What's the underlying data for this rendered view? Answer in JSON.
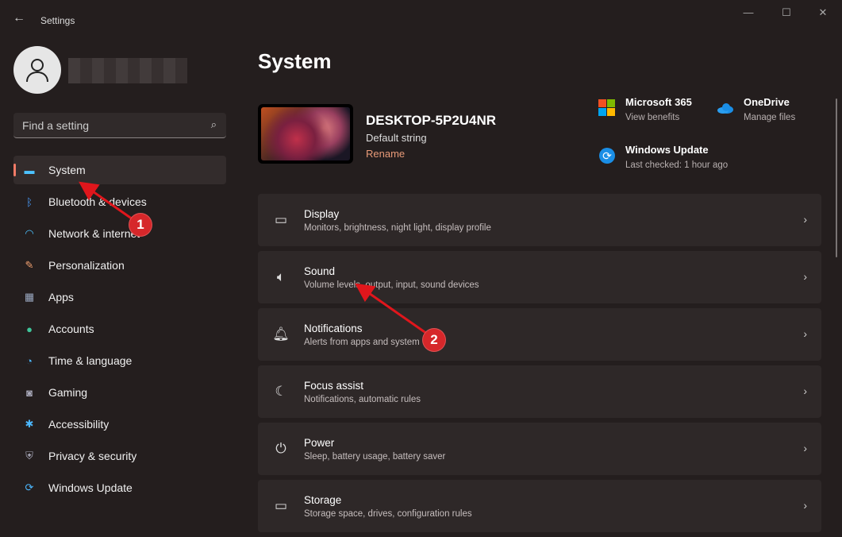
{
  "window": {
    "title": "Settings",
    "back": "←",
    "minimize": "—",
    "maximize": "☐",
    "close": "✕"
  },
  "search": {
    "placeholder": "Find a setting",
    "icon": "⌕"
  },
  "nav": [
    {
      "label": "System",
      "icon": "monitor",
      "glyph": "▬",
      "color": "#4cc2ff"
    },
    {
      "label": "Bluetooth & devices",
      "icon": "bluetooth",
      "glyph": "ᛒ",
      "color": "#4a9eff"
    },
    {
      "label": "Network & internet",
      "icon": "wifi",
      "glyph": "◠",
      "color": "#4cc2ff"
    },
    {
      "label": "Personalization",
      "icon": "brush",
      "glyph": "✎",
      "color": "#f0a070"
    },
    {
      "label": "Apps",
      "icon": "apps",
      "glyph": "▦",
      "color": "#9aa8c0"
    },
    {
      "label": "Accounts",
      "icon": "person",
      "glyph": "●",
      "color": "#3fc59a"
    },
    {
      "label": "Time & language",
      "icon": "globe-clock",
      "glyph": "◔",
      "color": "#4cb8ff"
    },
    {
      "label": "Gaming",
      "icon": "gamepad",
      "glyph": "◙",
      "color": "#aab"
    },
    {
      "label": "Accessibility",
      "icon": "accessibility",
      "glyph": "✱",
      "color": "#4cb8ff"
    },
    {
      "label": "Privacy & security",
      "icon": "shield",
      "glyph": "⛨",
      "color": "#aab"
    },
    {
      "label": "Windows Update",
      "icon": "update",
      "glyph": "⟳",
      "color": "#4cb8ff"
    }
  ],
  "page": {
    "title": "System"
  },
  "device": {
    "name": "DESKTOP-5P2U4NR",
    "subtitle": "Default string",
    "rename": "Rename"
  },
  "quick": {
    "m365": {
      "title": "Microsoft 365",
      "sub": "View benefits"
    },
    "onedrive": {
      "title": "OneDrive",
      "sub": "Manage files"
    },
    "update": {
      "title": "Windows Update",
      "sub": "Last checked: 1 hour ago"
    }
  },
  "cards": [
    {
      "title": "Display",
      "sub": "Monitors, brightness, night light, display profile",
      "glyph": "▭"
    },
    {
      "title": "Sound",
      "sub": "Volume levels, output, input, sound devices",
      "glyph": "🔈︎"
    },
    {
      "title": "Notifications",
      "sub": "Alerts from apps and system",
      "glyph": "🔔︎"
    },
    {
      "title": "Focus assist",
      "sub": "Notifications, automatic rules",
      "glyph": "☾"
    },
    {
      "title": "Power",
      "sub": "Sleep, battery usage, battery saver",
      "glyph": "⏻"
    },
    {
      "title": "Storage",
      "sub": "Storage space, drives, configuration rules",
      "glyph": "▭"
    }
  ],
  "chevron": "›",
  "annotations": [
    "1",
    "2"
  ]
}
